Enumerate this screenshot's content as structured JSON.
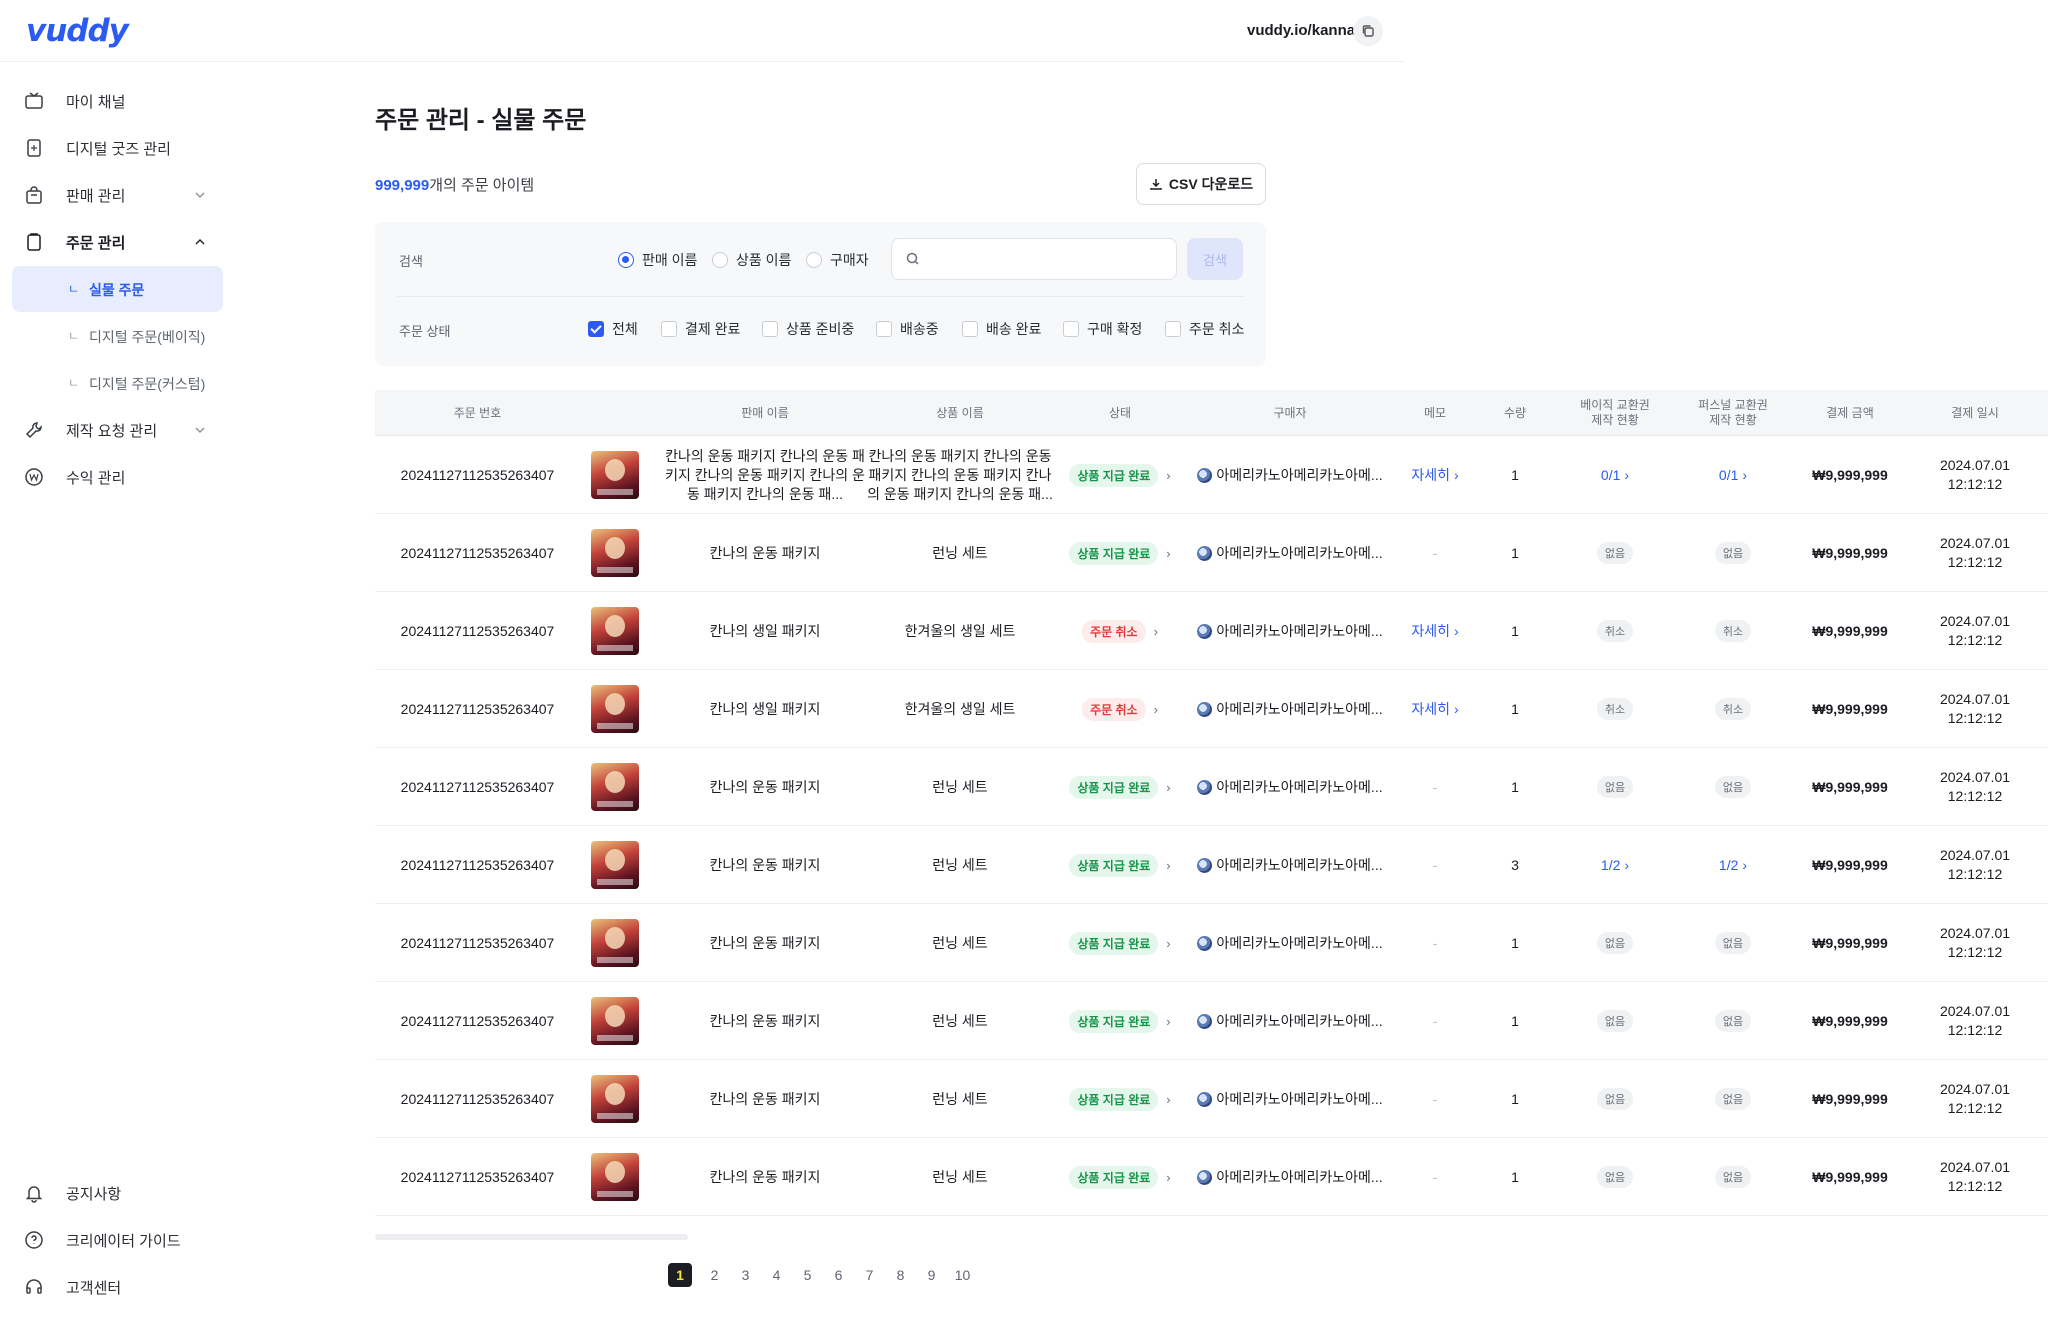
{
  "header": {
    "logo": "vuddy",
    "channel_url": "vuddy.io/kanna"
  },
  "sidebar": {
    "items": [
      {
        "label": "마이 채널",
        "icon": "tv-icon"
      },
      {
        "label": "디지털 굿즈 관리",
        "icon": "digital-card-icon"
      },
      {
        "label": "판매 관리",
        "icon": "shopping-bag-icon"
      },
      {
        "label": "주문 관리",
        "icon": "clipboard-icon"
      },
      {
        "label": "제작 요청 관리",
        "icon": "wrench-icon"
      },
      {
        "label": "수익 관리",
        "icon": "won-coin-icon"
      }
    ],
    "sub_items": [
      {
        "mark": "ㄴ",
        "label": "실물 주문"
      },
      {
        "mark": "ㄴ",
        "label": "디지털 주문(베이직)"
      },
      {
        "mark": "ㄴ",
        "label": "디지털 주문(커스텀)"
      }
    ],
    "footer": [
      {
        "label": "공지사항",
        "icon": "bell-icon"
      },
      {
        "label": "크리에이터 가이드",
        "icon": "help-circle-icon"
      },
      {
        "label": "고객센터",
        "icon": "headset-icon"
      }
    ]
  },
  "page": {
    "title": "주문 관리 - 실물 주문",
    "count": "999,999",
    "count_suffix": "개의 주문 아이템",
    "csv_label": "CSV 다운로드"
  },
  "filter": {
    "search_label": "검색",
    "radios": [
      "판매 이름",
      "상품 이름",
      "구매자"
    ],
    "selected_radio": "판매 이름",
    "search_value": "",
    "search_button": "검색",
    "status_label": "주문 상태",
    "checks": [
      "전체",
      "결제 완료",
      "상품 준비중",
      "배송중",
      "배송 완료",
      "구매 확정",
      "주문 취소"
    ],
    "checked": "전체"
  },
  "table": {
    "headers": {
      "order_no": "주문 번호",
      "sale_name": "판매 이름",
      "product_name": "상품 이름",
      "status": "상태",
      "buyer": "구매자",
      "memo": "메모",
      "qty": "수량",
      "basic_l1": "베이직 교환권",
      "basic_l2": "제작 현황",
      "personal_l1": "퍼스널 교환권",
      "personal_l2": "제작 현황",
      "amount": "결제 금액",
      "date": "결제 일시"
    },
    "rows": [
      {
        "order_no": "20241127112535263407",
        "sale_name": "칸나의 운동 패키지 칸나의 운동 패키지 칸나의 운동 패키지 칸나의 운동 패키지 칸나의 운동 패...",
        "product_name": "칸나의 운동 패키지 칸나의 운동 패키지 칸나의 운동 패키지 칸나의 운동 패키지 칸나의 운동 패...",
        "status": "상품 지급 완료",
        "status_color": "green",
        "buyer": "아메리카노아메리카노아메...",
        "memo": "자세히",
        "qty": "1",
        "basic": "0/1",
        "personal": "0/1",
        "amount": "₩9,999,999",
        "date1": "2024.07.01",
        "date2": "12:12:12"
      },
      {
        "order_no": "20241127112535263407",
        "sale_name": "칸나의 운동 패키지",
        "product_name": "런닝 세트",
        "status": "상품 지급 완료",
        "status_color": "green",
        "buyer": "아메리카노아메리카노아메...",
        "memo": "-",
        "qty": "1",
        "basic": "없음",
        "personal": "없음",
        "amount": "₩9,999,999",
        "date1": "2024.07.01",
        "date2": "12:12:12"
      },
      {
        "order_no": "20241127112535263407",
        "sale_name": "칸나의 생일 패키지",
        "product_name": "한겨울의 생일 세트",
        "status": "주문 취소",
        "status_color": "red",
        "buyer": "아메리카노아메리카노아메...",
        "memo": "자세히",
        "qty": "1",
        "basic": "취소",
        "personal": "취소",
        "amount": "₩9,999,999",
        "date1": "2024.07.01",
        "date2": "12:12:12"
      },
      {
        "order_no": "20241127112535263407",
        "sale_name": "칸나의 생일 패키지",
        "product_name": "한겨울의 생일 세트",
        "status": "주문 취소",
        "status_color": "red",
        "buyer": "아메리카노아메리카노아메...",
        "memo": "자세히",
        "qty": "1",
        "basic": "취소",
        "personal": "취소",
        "amount": "₩9,999,999",
        "date1": "2024.07.01",
        "date2": "12:12:12"
      },
      {
        "order_no": "20241127112535263407",
        "sale_name": "칸나의 운동 패키지",
        "product_name": "런닝 세트",
        "status": "상품 지급 완료",
        "status_color": "green",
        "buyer": "아메리카노아메리카노아메...",
        "memo": "-",
        "qty": "1",
        "basic": "없음",
        "personal": "없음",
        "amount": "₩9,999,999",
        "date1": "2024.07.01",
        "date2": "12:12:12"
      },
      {
        "order_no": "20241127112535263407",
        "sale_name": "칸나의 운동 패키지",
        "product_name": "런닝 세트",
        "status": "상품 지급 완료",
        "status_color": "green",
        "buyer": "아메리카노아메리카노아메...",
        "memo": "-",
        "qty": "3",
        "basic": "1/2",
        "personal": "1/2",
        "amount": "₩9,999,999",
        "date1": "2024.07.01",
        "date2": "12:12:12"
      },
      {
        "order_no": "20241127112535263407",
        "sale_name": "칸나의 운동 패키지",
        "product_name": "런닝 세트",
        "status": "상품 지급 완료",
        "status_color": "green",
        "buyer": "아메리카노아메리카노아메...",
        "memo": "-",
        "qty": "1",
        "basic": "없음",
        "personal": "없음",
        "amount": "₩9,999,999",
        "date1": "2024.07.01",
        "date2": "12:12:12"
      },
      {
        "order_no": "20241127112535263407",
        "sale_name": "칸나의 운동 패키지",
        "product_name": "런닝 세트",
        "status": "상품 지급 완료",
        "status_color": "green",
        "buyer": "아메리카노아메리카노아메...",
        "memo": "-",
        "qty": "1",
        "basic": "없음",
        "personal": "없음",
        "amount": "₩9,999,999",
        "date1": "2024.07.01",
        "date2": "12:12:12"
      },
      {
        "order_no": "20241127112535263407",
        "sale_name": "칸나의 운동 패키지",
        "product_name": "런닝 세트",
        "status": "상품 지급 완료",
        "status_color": "green",
        "buyer": "아메리카노아메리카노아메...",
        "memo": "-",
        "qty": "1",
        "basic": "없음",
        "personal": "없음",
        "amount": "₩9,999,999",
        "date1": "2024.07.01",
        "date2": "12:12:12"
      },
      {
        "order_no": "20241127112535263407",
        "sale_name": "칸나의 운동 패키지",
        "product_name": "런닝 세트",
        "status": "상품 지급 완료",
        "status_color": "green",
        "buyer": "아메리카노아메리카노아메...",
        "memo": "-",
        "qty": "1",
        "basic": "없음",
        "personal": "없음",
        "amount": "₩9,999,999",
        "date1": "2024.07.01",
        "date2": "12:12:12"
      }
    ]
  },
  "pagination": {
    "pages": [
      "1",
      "2",
      "3",
      "4",
      "5",
      "6",
      "7",
      "8",
      "9",
      "10"
    ],
    "current": "1"
  },
  "colors": {
    "accent": "#2b5bf0",
    "success": "#17964a",
    "danger": "#e23b3b",
    "active_page_bg": "#1b1d22",
    "active_page_text": "#f7e33b"
  }
}
